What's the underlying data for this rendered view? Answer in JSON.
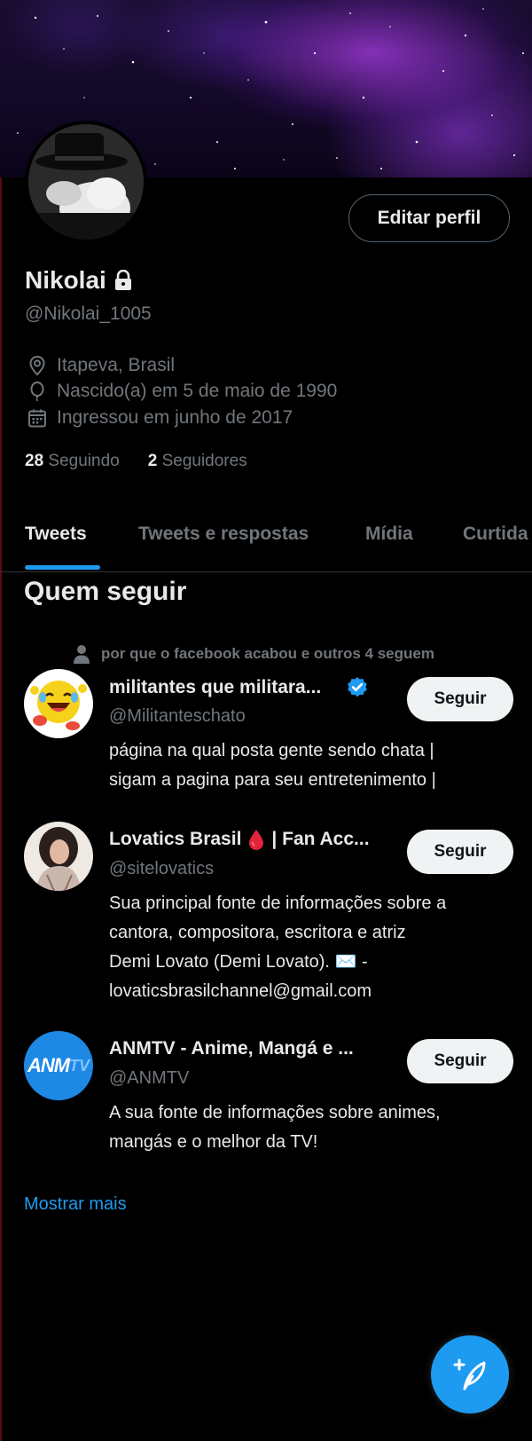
{
  "profile": {
    "name": "Nikolai",
    "handle": "@Nikolai_1005",
    "edit_label": "Editar perfil",
    "location": "Itapeva, Brasil",
    "birthday": "Nascido(a) em 5 de maio de 1990",
    "joined": "Ingressou em junho de 2017",
    "following_count": "28",
    "following_label": "Seguindo",
    "followers_count": "2",
    "followers_label": "Seguidores"
  },
  "tabs": [
    {
      "label": "Tweets",
      "active": true
    },
    {
      "label": "Tweets e respostas",
      "active": false
    },
    {
      "label": "Mídia",
      "active": false
    },
    {
      "label": "Curtida",
      "active": false
    }
  ],
  "who_to_follow": {
    "title": "Quem seguir",
    "social_context": "por que o facebook acabou e outros 4 seguem",
    "follow_label": "Seguir",
    "users": [
      {
        "name": "militantes que militara...",
        "verified": true,
        "handle": "@Militanteschato",
        "bio": [
          "página na qual posta gente sendo chata |",
          "sigam a pagina para seu entretenimento |"
        ]
      },
      {
        "name": "Lovatics Brasil",
        "name_suffix": "| Fan Acc...",
        "handle": "@sitelovatics",
        "bio": [
          "Sua principal fonte de informações sobre a",
          "cantora, compositora, escritora e atriz",
          "Demi Lovato (Demi Lovato). ✉️ -",
          "lovaticsbrasilchannel@gmail.com"
        ]
      },
      {
        "name": "ANMTV - Anime, Mangá e ...",
        "handle": "@ANMTV",
        "avatar_text": "ANM",
        "avatar_text_2": "TV",
        "bio": [
          "A sua fonte de informações sobre animes,",
          "mangás e o melhor da TV!"
        ]
      }
    ],
    "show_more": "Mostrar mais"
  },
  "colors": {
    "accent": "#1d9bf0",
    "background": "#000000",
    "muted_text": "#71767b",
    "primary_text": "#e7e9ea"
  },
  "icons": [
    "lock-icon",
    "location-pin-icon",
    "balloon-icon",
    "calendar-icon",
    "person-icon",
    "verified-badge-icon",
    "blood-drop-icon",
    "compose-tweet-icon"
  ]
}
